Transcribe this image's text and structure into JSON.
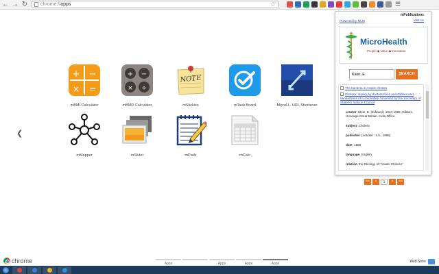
{
  "browser": {
    "url_scheme": "chrome://",
    "url_path": "apps",
    "extension_colors": [
      "#d9534f",
      "#2f6db5",
      "#1aa05b",
      "#333333",
      "#e6a619",
      "#7a4fb5",
      "#e63a3a",
      "#2aa7e0",
      "#5fbf3a",
      "#444444",
      "#f28c28",
      "#3b5998",
      "#999999"
    ]
  },
  "apps": [
    {
      "label": "mBMI Calculator",
      "icon": "calculator-orange-icon"
    },
    {
      "label": "mBMR Calculator",
      "icon": "calculator-gray-icon"
    },
    {
      "label": "mStickies",
      "icon": "sticky-note-icon"
    },
    {
      "label": "mTask Board",
      "icon": "checkmark-icon"
    },
    {
      "label": "MicroH - URL Shortener",
      "icon": "link-arrows-icon"
    },
    {
      "label": "mMapper",
      "icon": "mind-map-icon"
    },
    {
      "label": "mSlider",
      "icon": "slides-icon"
    },
    {
      "label": "mPads",
      "icon": "notepad-icon"
    },
    {
      "label": "mCalc",
      "icon": "spreadsheet-icon"
    }
  ],
  "popup": {
    "title": "mPublications",
    "powered_by": "Powered by NLM",
    "visit": "Visit us",
    "logo_name": "MicroHealth",
    "logo_tagline": "People ◆ Value ◆ Innovation",
    "search_value": "Klein, E.",
    "search_button": "SEARCH",
    "results": {
      "item1": "The bacteria in Asiatic cholera",
      "item2": "Cholera: inquiry by doctors Klein and Gibbes and transactions of a committee convened by the Secretary of State for India in Council",
      "fields": [
        {
          "name": "creator",
          "value": "Klein, E. (Edward), 1844-1925.;Gibbes, Heneage.Great Britain. India Office."
        },
        {
          "name": "subject",
          "value": "Cholera"
        },
        {
          "name": "publisher",
          "value": "[London : s.n., 1885]"
        },
        {
          "name": "date",
          "value": "1885"
        },
        {
          "name": "language",
          "value": "English"
        },
        {
          "name": "relation",
          "value": "the Etiology of \"Asiatic Cholera\""
        }
      ]
    },
    "pager": [
      "<<",
      "<",
      "1",
      ">",
      ">>"
    ]
  },
  "bottom": {
    "brand": "chrome",
    "pages": [
      "Apps",
      "",
      "Apps",
      "Apps",
      "Apps"
    ],
    "active_page": 4,
    "webstore": "Web Store"
  },
  "taskbar": {
    "item_colors": [
      "#db4437",
      "#3b7dd8",
      "#f2b01e",
      "#2a8fd8"
    ]
  }
}
